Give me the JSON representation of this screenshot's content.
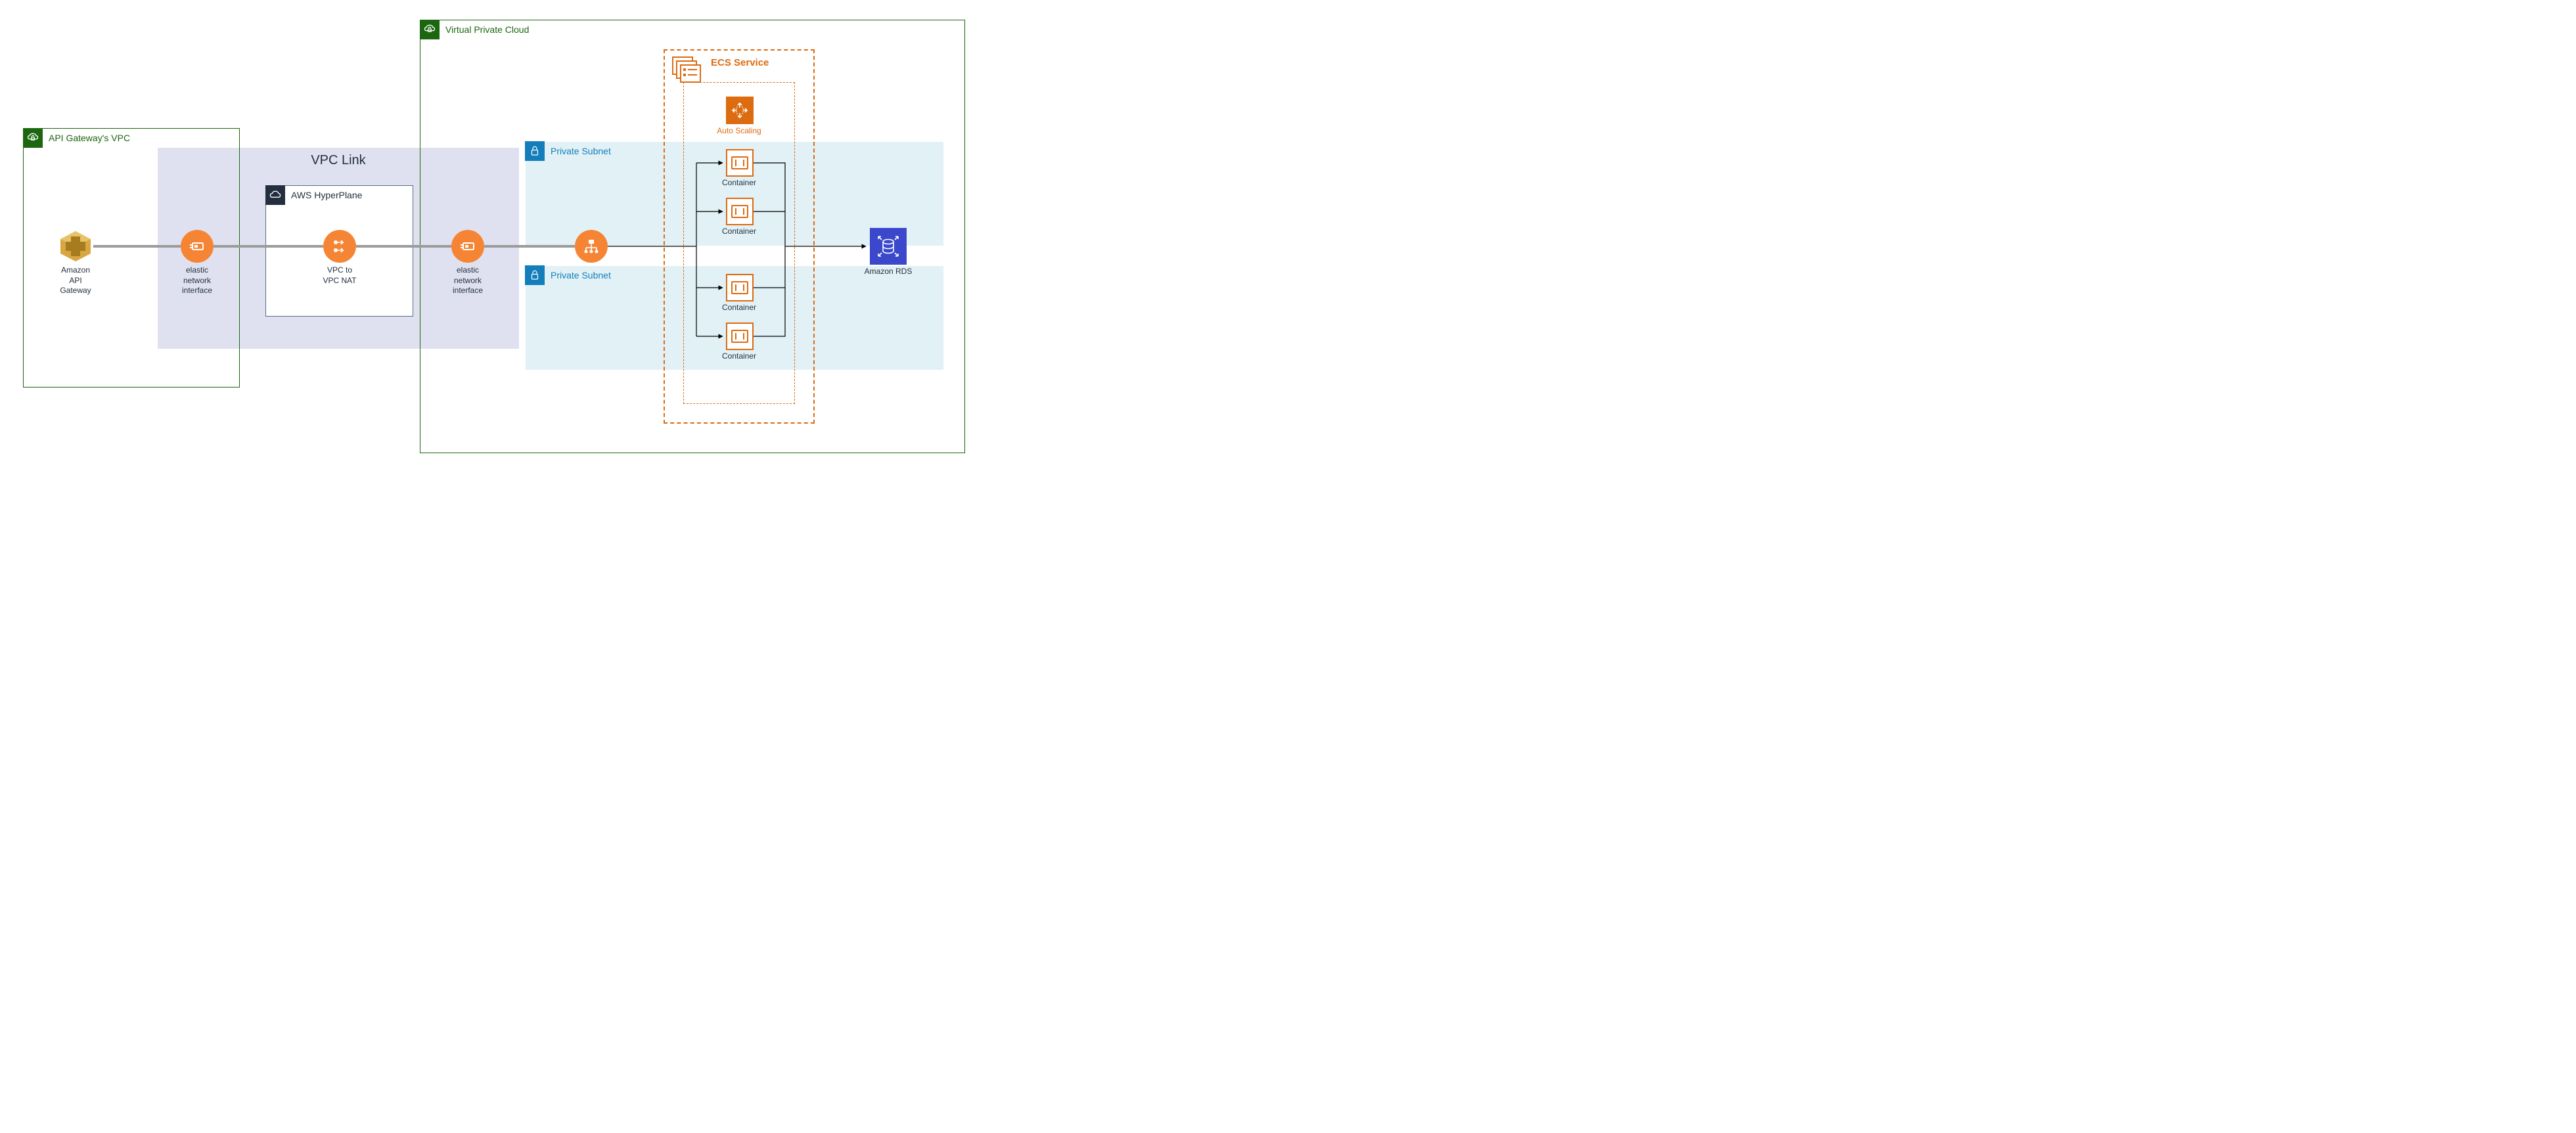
{
  "diagram": {
    "apiGatewayVpc": "API Gateway's VPC",
    "apiGateway": "Amazon\nAPI\nGateway",
    "vpcLink": "VPC Link",
    "eni1": "elastic\nnetwork\ninterface",
    "hyperplane": "AWS HyperPlane",
    "vpcNat": "VPC to\nVPC NAT",
    "eni2": "elastic\nnetwork\ninterface",
    "customerVpc": "Virtual Private Cloud",
    "privateSubnet1": "Private Subnet",
    "privateSubnet2": "Private Subnet",
    "ecsService": "ECS Service",
    "autoScaling": "Auto Scaling",
    "container": "Container",
    "rds": "Amazon RDS"
  }
}
